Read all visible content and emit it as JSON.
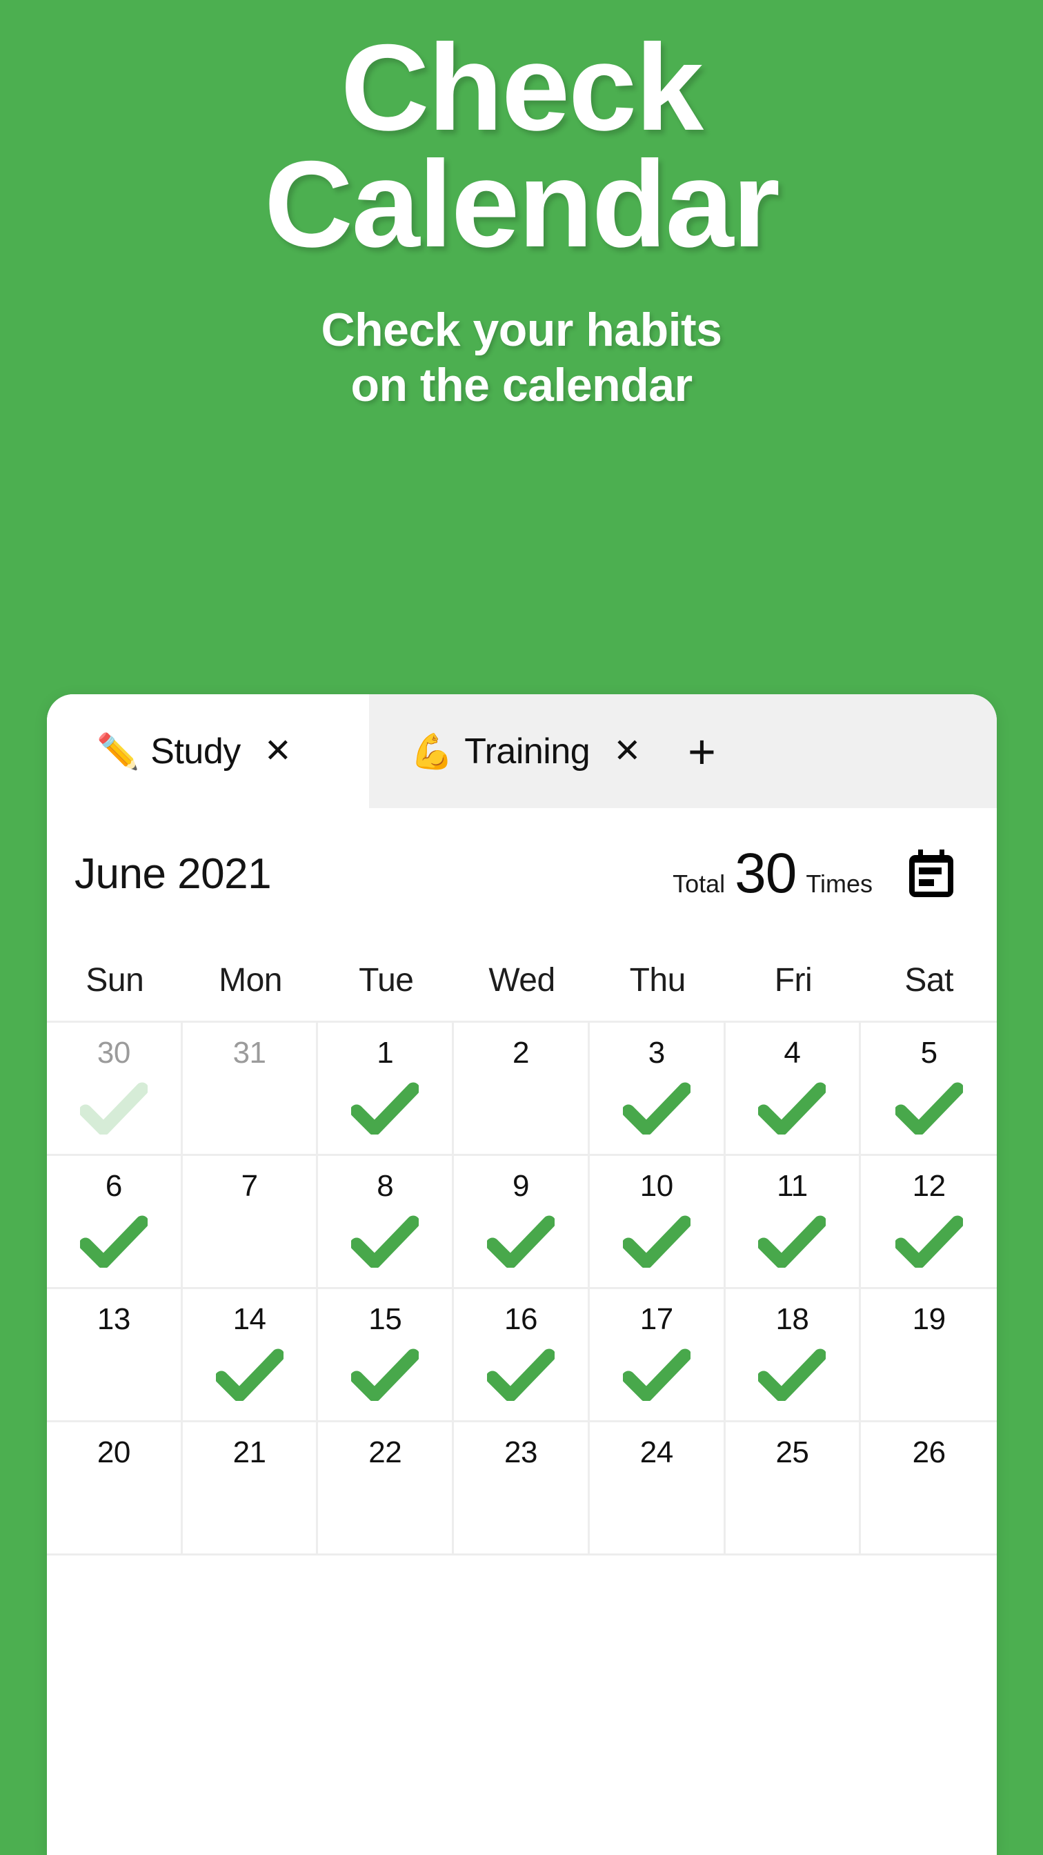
{
  "theme": {
    "background_green": "#4CAF50",
    "check_green": "#48A84B",
    "check_faded_green": "#A5D6A7",
    "card_background": "#FFFFFF",
    "tabstrip_background": "#F0F0F0",
    "grid_line": "#EDEDED"
  },
  "promo": {
    "title_lines": [
      "Check",
      "Calendar"
    ],
    "subtitle_lines": [
      "Check your habits",
      "on the calendar"
    ]
  },
  "tabs": {
    "items": [
      {
        "emoji": "✏️",
        "emoji_name": "pencil-emoji",
        "label": "Study",
        "close_label": "✕",
        "active": true
      },
      {
        "emoji": "💪",
        "emoji_name": "flexed-biceps-emoji",
        "label": "Training",
        "close_label": "✕",
        "active": false
      }
    ],
    "add_label": "+"
  },
  "month_header": {
    "title": "June 2021",
    "total_label": "Total",
    "total_value": "30",
    "total_unit": "Times",
    "icon": "calendar-icon"
  },
  "calendar": {
    "weekdays": [
      "Sun",
      "Mon",
      "Tue",
      "Wed",
      "Thu",
      "Fri",
      "Sat"
    ],
    "weeks": [
      [
        {
          "day": "30",
          "other_month": true,
          "checked": true,
          "faded": true
        },
        {
          "day": "31",
          "other_month": true,
          "checked": false,
          "faded": false
        },
        {
          "day": "1",
          "other_month": false,
          "checked": true,
          "faded": false
        },
        {
          "day": "2",
          "other_month": false,
          "checked": false,
          "faded": false
        },
        {
          "day": "3",
          "other_month": false,
          "checked": true,
          "faded": false
        },
        {
          "day": "4",
          "other_month": false,
          "checked": true,
          "faded": false
        },
        {
          "day": "5",
          "other_month": false,
          "checked": true,
          "faded": false
        }
      ],
      [
        {
          "day": "6",
          "other_month": false,
          "checked": true,
          "faded": false
        },
        {
          "day": "7",
          "other_month": false,
          "checked": false,
          "faded": false
        },
        {
          "day": "8",
          "other_month": false,
          "checked": true,
          "faded": false
        },
        {
          "day": "9",
          "other_month": false,
          "checked": true,
          "faded": false
        },
        {
          "day": "10",
          "other_month": false,
          "checked": true,
          "faded": false
        },
        {
          "day": "11",
          "other_month": false,
          "checked": true,
          "faded": false
        },
        {
          "day": "12",
          "other_month": false,
          "checked": true,
          "faded": false
        }
      ],
      [
        {
          "day": "13",
          "other_month": false,
          "checked": false,
          "faded": false
        },
        {
          "day": "14",
          "other_month": false,
          "checked": true,
          "faded": false
        },
        {
          "day": "15",
          "other_month": false,
          "checked": true,
          "faded": false
        },
        {
          "day": "16",
          "other_month": false,
          "checked": true,
          "faded": false
        },
        {
          "day": "17",
          "other_month": false,
          "checked": true,
          "faded": false
        },
        {
          "day": "18",
          "other_month": false,
          "checked": true,
          "faded": false
        },
        {
          "day": "19",
          "other_month": false,
          "checked": false,
          "faded": false
        }
      ],
      [
        {
          "day": "20",
          "other_month": false,
          "checked": false,
          "faded": false
        },
        {
          "day": "21",
          "other_month": false,
          "checked": false,
          "faded": false
        },
        {
          "day": "22",
          "other_month": false,
          "checked": false,
          "faded": false
        },
        {
          "day": "23",
          "other_month": false,
          "checked": false,
          "faded": false
        },
        {
          "day": "24",
          "other_month": false,
          "checked": false,
          "faded": false
        },
        {
          "day": "25",
          "other_month": false,
          "checked": false,
          "faded": false
        },
        {
          "day": "26",
          "other_month": false,
          "checked": false,
          "faded": false
        }
      ]
    ]
  }
}
